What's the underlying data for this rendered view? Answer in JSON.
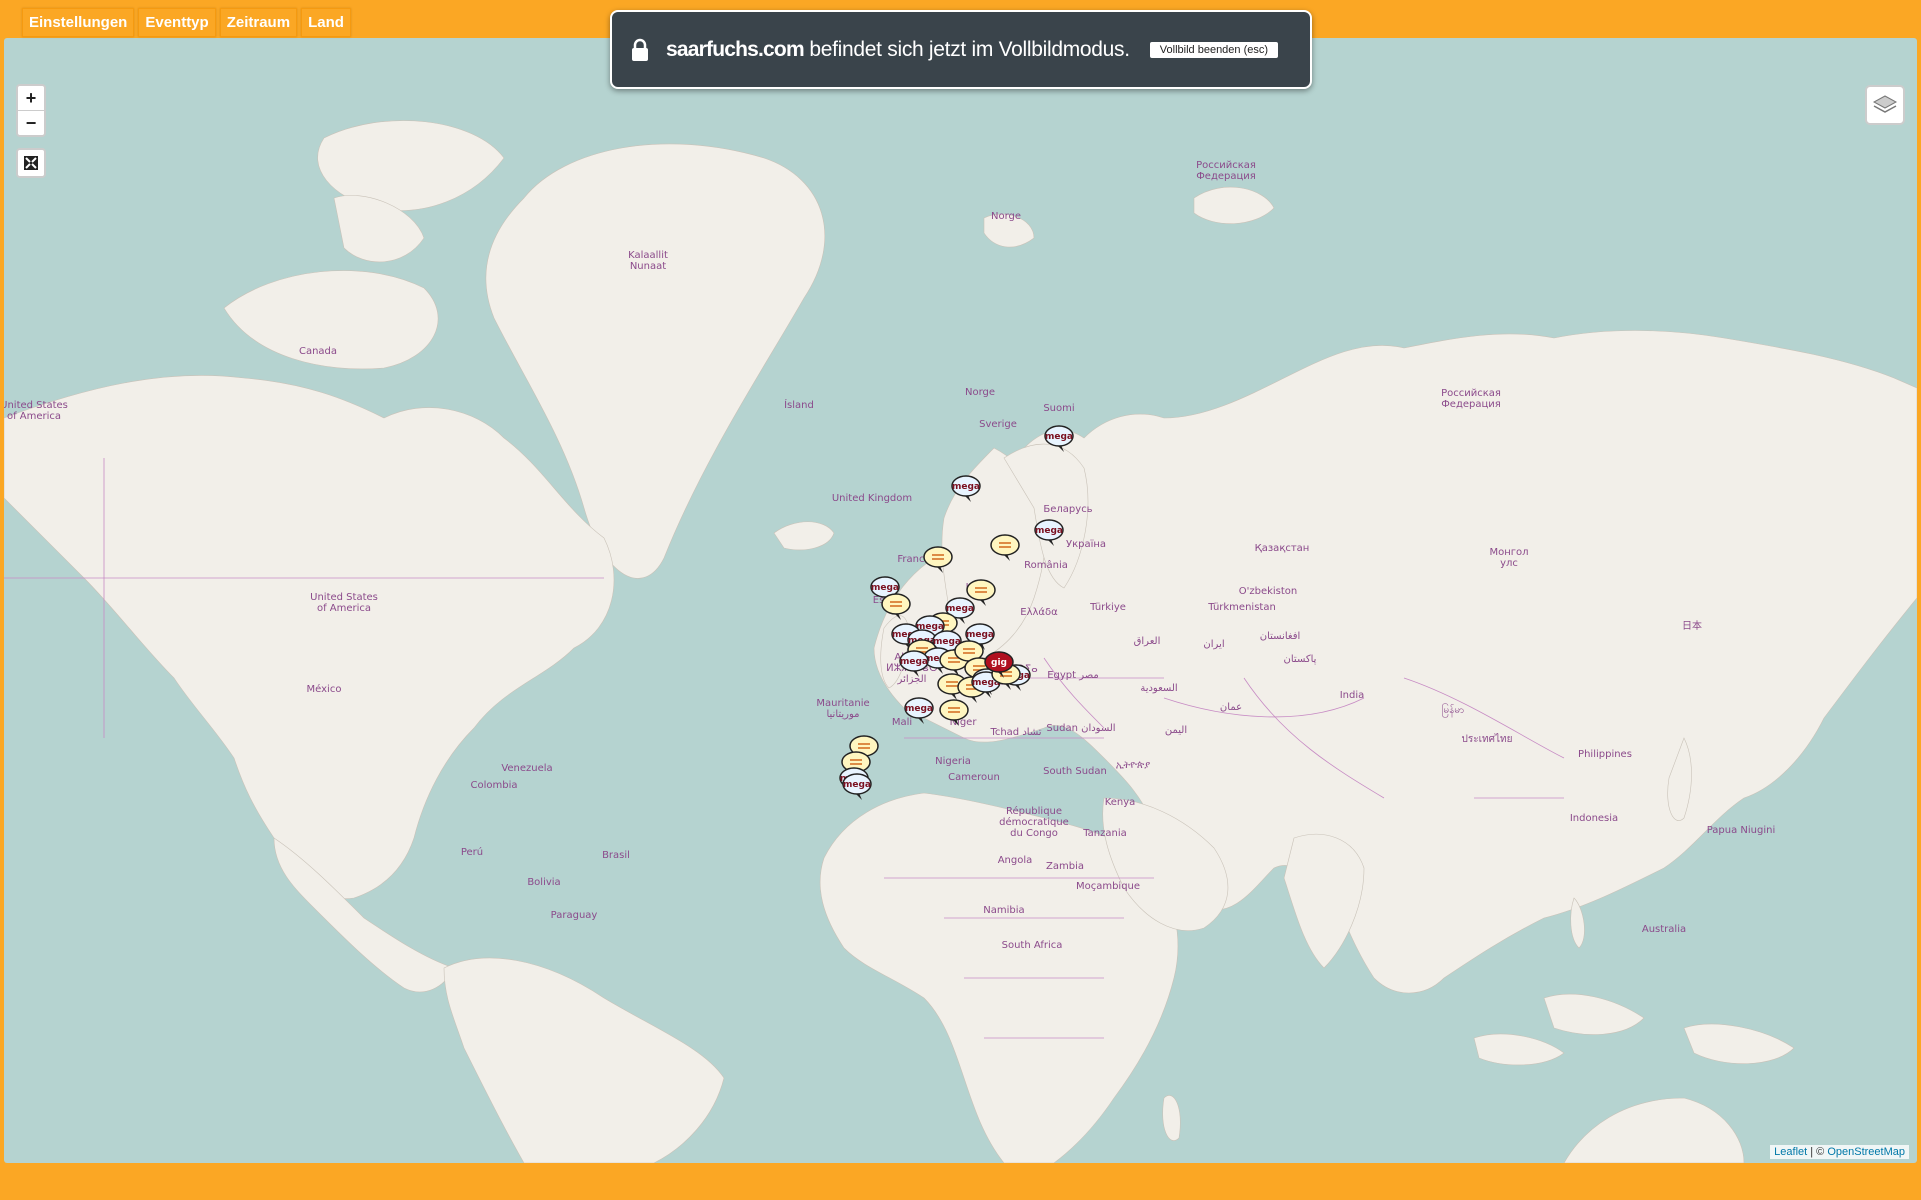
{
  "menu": [
    "Einstellungen",
    "Eventtyp",
    "Zeitraum",
    "Land"
  ],
  "zoom": {
    "in": "+",
    "out": "−"
  },
  "fullscreen_notice": {
    "domain": "saarfuchs.com",
    "message": "befindet sich jetzt im Vollbildmodus.",
    "exit_button": "Vollbild beenden (esc)"
  },
  "attribution": {
    "leaflet": "Leaflet",
    "separator": "| ©",
    "osm": "OpenStreetMap"
  },
  "colors": {
    "frame": "#fba724",
    "water": "#b5d3d0",
    "land": "#f2efe9",
    "border": "#c78bc4",
    "marker_mega": "#7a1020",
    "marker_gig": "#c0102a"
  },
  "map_labels": [
    "Kalaallit\nNunaat",
    "Российская\nФедерация",
    "Norge",
    "Canada",
    "United States\nof America",
    "Ísland",
    "Norge",
    "Suomi",
    "Sverige",
    "United Kingdom",
    "Беларусь",
    "Україна",
    "Российская\nФедерация",
    "Қазақстан",
    "Монгол\nулс",
    "France",
    "România",
    "España",
    "Italia",
    "Türkiye",
    "Ελλάδα",
    "O'zbekiston",
    "Türkmenistan",
    "United States\nof America",
    "México",
    "Algérie\nⵍⵣⵣⴰⵢⴻⵔ\nالجزائر",
    "Libya ⵍⵉⴱⵢⴰ\nليبيا",
    "Egypt مصر",
    "العراق",
    "ایران",
    "افغانستان",
    "پاکستان",
    "日本",
    "السعودية",
    "عمان",
    "India",
    "မြန်မာ",
    "ประเทศไทย",
    "Philippines",
    "Mauritanie\nموريتانيا",
    "Mali",
    "Niger",
    "Tchad تشاد",
    "Sudan السودان",
    "اليمن",
    "Nigeria",
    "Cameroun",
    "South Sudan",
    "ኢትዮጵያ",
    "Venezuela",
    "Colombia",
    "République\ndémocratique\ndu Congo",
    "Kenya",
    "Tanzania",
    "Indonesia",
    "Papua Niugini",
    "Perú",
    "Brasil",
    "Bolivia",
    "Angola",
    "Zambia",
    "Moçambique",
    "Paraguay",
    "Namibia",
    "Australia",
    "South Africa"
  ],
  "markers": {
    "mega_label": "mega",
    "gig_label": "gig",
    "types": [
      "mega",
      "mega",
      "mega",
      "event",
      "event",
      "mega",
      "event",
      "event",
      "mega",
      "event",
      "mega",
      "mega",
      "mega",
      "mega",
      "mega",
      "event",
      "mega",
      "mega",
      "event",
      "event",
      "event",
      "mega",
      "event",
      "event",
      "mega",
      "mega",
      "event",
      "gig",
      "mega",
      "event",
      "event",
      "event",
      "mega",
      "mega"
    ]
  }
}
